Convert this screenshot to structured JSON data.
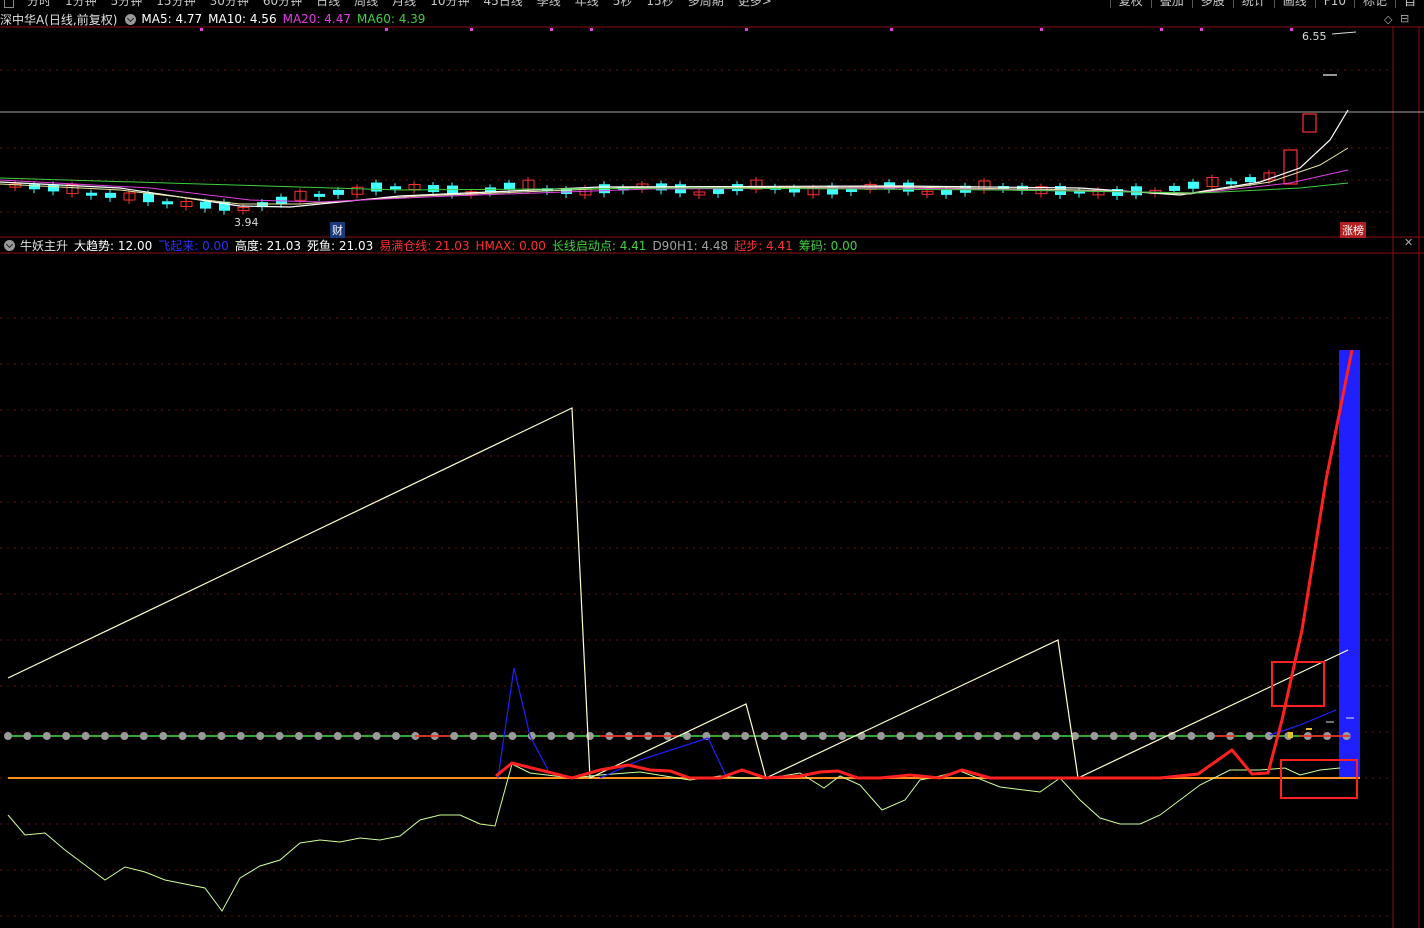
{
  "toolbar": {
    "periods": [
      "分时",
      "1分钟",
      "5分钟",
      "15分钟",
      "30分钟",
      "60分钟",
      "日线",
      "周线",
      "月线",
      "10分钟",
      "45日线",
      "季线",
      "年线",
      "5秒",
      "15秒",
      "多周期",
      "更多>"
    ],
    "right": [
      "复权",
      "叠加",
      "多股",
      "统计",
      "画线",
      "F10",
      "标记",
      "自"
    ]
  },
  "main_chart": {
    "title": "深中华A(日线,前复权)",
    "indicators": [
      {
        "label": "MA5: 4.77",
        "color": "#ffffff"
      },
      {
        "label": "MA10: 4.56",
        "color": "#ffffff"
      },
      {
        "label": "MA20: 4.47",
        "color": "#e040e0"
      },
      {
        "label": "MA60: 4.39",
        "color": "#40d040"
      }
    ],
    "high_label": "6.55",
    "low_label": "3.94",
    "cai_label": "财",
    "limit_label": "涨榜",
    "colors": {
      "up": "#ff3030",
      "down": "#40ffff",
      "ma5": "#ffffff",
      "ma10": "#e8e8a0",
      "ma20": "#e040e0",
      "ma60": "#40d040"
    },
    "chart_data": {
      "type": "candlestick",
      "high": 6.55,
      "low": 3.94,
      "ma": {
        "MA5": 4.77,
        "MA10": 4.56,
        "MA20": 4.47,
        "MA60": 4.39
      }
    }
  },
  "indicator_panel": {
    "name": "牛妖主升",
    "fields": [
      {
        "label": "大趋势: 12.00",
        "color": "#ffffff"
      },
      {
        "label": "飞起来: 0.00",
        "color": "#3030ff"
      },
      {
        "label": "高度: 21.03",
        "color": "#ffffff"
      },
      {
        "label": "死鱼: 21.03",
        "color": "#ffffff"
      },
      {
        "label": "易满仓线: 21.03",
        "color": "#ff3030"
      },
      {
        "label": "HMAX: 0.00",
        "color": "#ff3030"
      },
      {
        "label": "长线启动点: 4.41",
        "color": "#40d040"
      },
      {
        "label": "D90H1: 4.48",
        "color": "#a0a0a0"
      },
      {
        "label": "起步: 4.41",
        "color": "#ff3030"
      },
      {
        "label": "筹码: 0.00",
        "color": "#40d040"
      }
    ],
    "colors": {
      "trend": "#ffffcc",
      "lower": "#ccff99",
      "red": "#ff2020",
      "blue": "#2020ff",
      "green": "#40e040",
      "orange": "#ff9020"
    }
  }
}
